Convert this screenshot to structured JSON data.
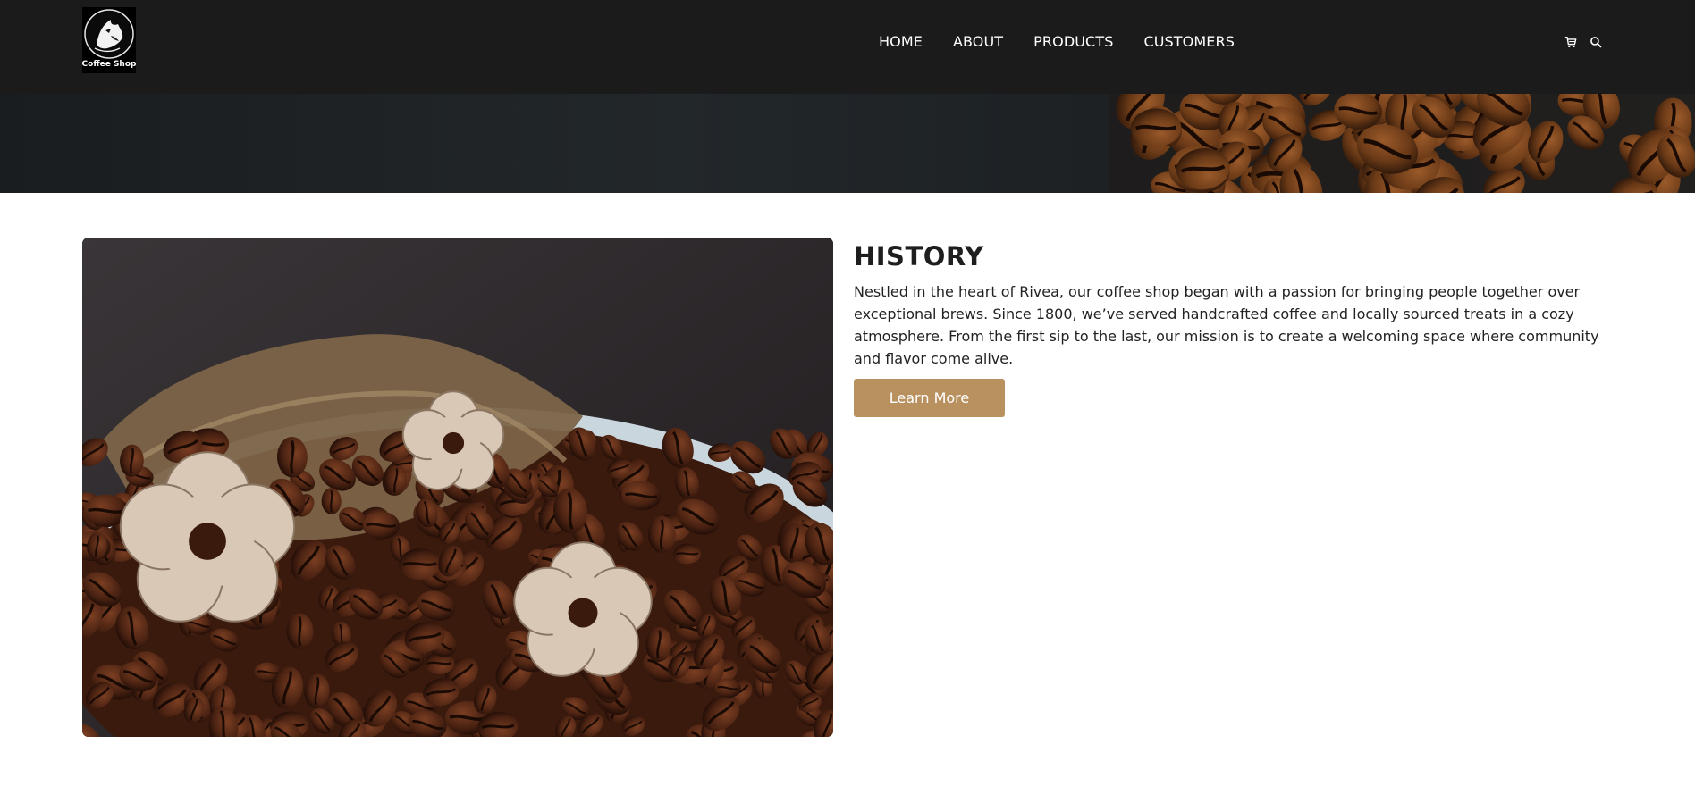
{
  "brand": {
    "logo_text": "Coffee Shop"
  },
  "nav": {
    "items": [
      {
        "label": "HOME"
      },
      {
        "label": "ABOUT"
      },
      {
        "label": "PRODUCTS"
      },
      {
        "label": "CUSTOMERS"
      }
    ]
  },
  "header_icons": [
    "cart-icon",
    "search-icon"
  ],
  "history": {
    "title": "HISTORY",
    "body": "Nestled in the heart of Rivea, our coffee shop began with a passion for bringing people together over exceptional brews. Since 1800, we’ve served handcrafted coffee and locally sourced treats in a cozy atmosphere. From the first sip to the last, our mission is to create a welcoming space where community and flavor come alive.",
    "button_label": "Learn More"
  },
  "colors": {
    "header_bg": "#1b1b1b",
    "accent": "#b8915f"
  }
}
